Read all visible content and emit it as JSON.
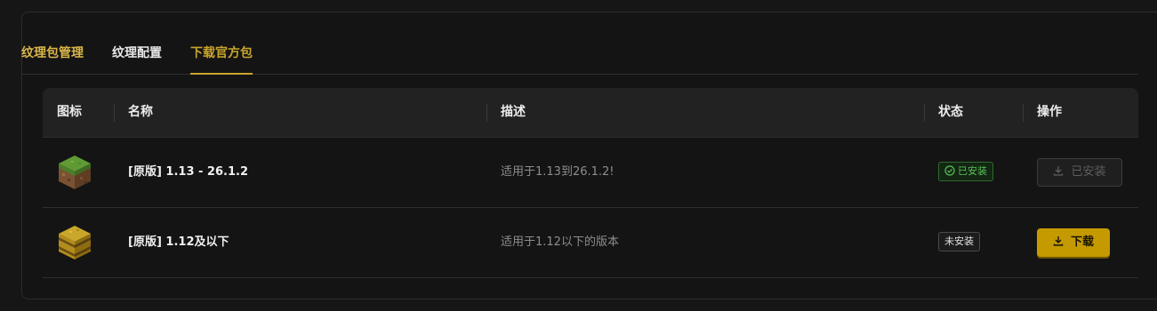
{
  "tabs": [
    {
      "label": "纹理包管理",
      "color": "#d9b64a"
    },
    {
      "label": "纹理配置",
      "color": "#e8e8e8"
    },
    {
      "label": "下载官方包",
      "color": "#c9a52c",
      "active": true
    }
  ],
  "table": {
    "headers": {
      "icon": "图标",
      "name": "名称",
      "desc": "描述",
      "status": "状态",
      "action": "操作"
    },
    "rows": [
      {
        "icon": "grass-block-icon",
        "name": "[原版] 1.13 - 26.1.2",
        "desc": "适用于1.13到26.1.2!",
        "status": "已安装",
        "action": "已安装"
      },
      {
        "icon": "hay-bale-icon",
        "name": "[原版] 1.12及以下",
        "desc": "适用于1.12以下的版本",
        "status": "未安装",
        "action": "下载"
      }
    ]
  },
  "colors": {
    "accent": "#c49a00",
    "installed_green": "#58c058"
  }
}
